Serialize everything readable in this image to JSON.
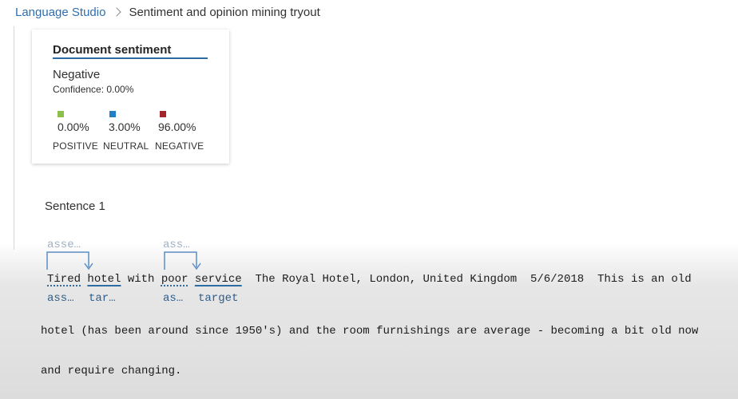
{
  "breadcrumb": {
    "root": "Language Studio",
    "current": "Sentiment and opinion mining tryout"
  },
  "document_sentiment": {
    "title": "Document sentiment",
    "label": "Negative",
    "confidence": "Confidence: 0.00%",
    "scores": [
      {
        "category": "POSITIVE",
        "value": "0.00%",
        "color": "#8cc04b"
      },
      {
        "category": "NEUTRAL",
        "value": "3.00%",
        "color": "#1f80c8"
      },
      {
        "category": "NEGATIVE",
        "value": "96.00%",
        "color": "#a4262c"
      }
    ]
  },
  "sentence": {
    "heading": "Sentence 1",
    "annotations_top": [
      "asse…",
      "ass…"
    ],
    "words": {
      "w1": "Tired",
      "w2": "hotel",
      "w3": "with",
      "w4": "poor",
      "w5": "service",
      "rest": "The Royal Hotel, London, United Kingdom  5/6/2018  This is an old"
    },
    "annotations_bottom": [
      "ass…",
      "tar…",
      "as…",
      "target"
    ],
    "continuation": [
      "hotel (has been around since 1950's) and the room furnishings are average - becoming a bit old now",
      "and require changing."
    ]
  }
}
